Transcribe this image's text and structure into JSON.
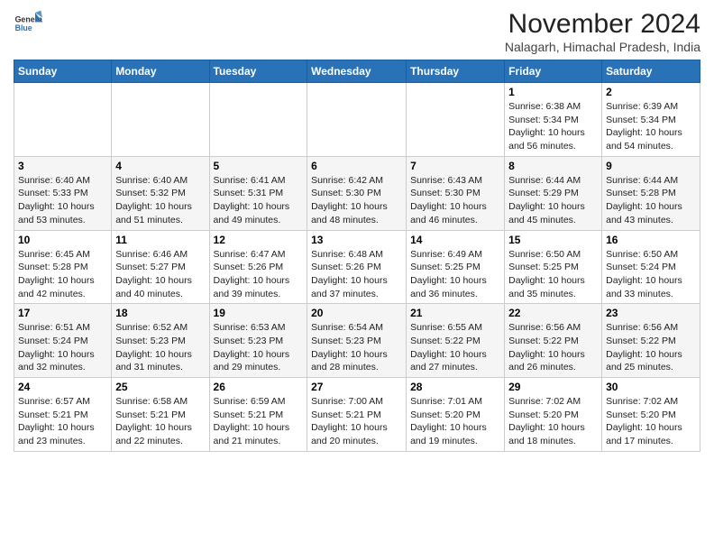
{
  "header": {
    "logo": {
      "line1": "General",
      "line2": "Blue"
    },
    "month": "November 2024",
    "location": "Nalagarh, Himachal Pradesh, India"
  },
  "weekdays": [
    "Sunday",
    "Monday",
    "Tuesday",
    "Wednesday",
    "Thursday",
    "Friday",
    "Saturday"
  ],
  "weeks": [
    [
      {
        "day": "",
        "info": ""
      },
      {
        "day": "",
        "info": ""
      },
      {
        "day": "",
        "info": ""
      },
      {
        "day": "",
        "info": ""
      },
      {
        "day": "",
        "info": ""
      },
      {
        "day": "1",
        "info": "Sunrise: 6:38 AM\nSunset: 5:34 PM\nDaylight: 10 hours and 56 minutes."
      },
      {
        "day": "2",
        "info": "Sunrise: 6:39 AM\nSunset: 5:34 PM\nDaylight: 10 hours and 54 minutes."
      }
    ],
    [
      {
        "day": "3",
        "info": "Sunrise: 6:40 AM\nSunset: 5:33 PM\nDaylight: 10 hours and 53 minutes."
      },
      {
        "day": "4",
        "info": "Sunrise: 6:40 AM\nSunset: 5:32 PM\nDaylight: 10 hours and 51 minutes."
      },
      {
        "day": "5",
        "info": "Sunrise: 6:41 AM\nSunset: 5:31 PM\nDaylight: 10 hours and 49 minutes."
      },
      {
        "day": "6",
        "info": "Sunrise: 6:42 AM\nSunset: 5:30 PM\nDaylight: 10 hours and 48 minutes."
      },
      {
        "day": "7",
        "info": "Sunrise: 6:43 AM\nSunset: 5:30 PM\nDaylight: 10 hours and 46 minutes."
      },
      {
        "day": "8",
        "info": "Sunrise: 6:44 AM\nSunset: 5:29 PM\nDaylight: 10 hours and 45 minutes."
      },
      {
        "day": "9",
        "info": "Sunrise: 6:44 AM\nSunset: 5:28 PM\nDaylight: 10 hours and 43 minutes."
      }
    ],
    [
      {
        "day": "10",
        "info": "Sunrise: 6:45 AM\nSunset: 5:28 PM\nDaylight: 10 hours and 42 minutes."
      },
      {
        "day": "11",
        "info": "Sunrise: 6:46 AM\nSunset: 5:27 PM\nDaylight: 10 hours and 40 minutes."
      },
      {
        "day": "12",
        "info": "Sunrise: 6:47 AM\nSunset: 5:26 PM\nDaylight: 10 hours and 39 minutes."
      },
      {
        "day": "13",
        "info": "Sunrise: 6:48 AM\nSunset: 5:26 PM\nDaylight: 10 hours and 37 minutes."
      },
      {
        "day": "14",
        "info": "Sunrise: 6:49 AM\nSunset: 5:25 PM\nDaylight: 10 hours and 36 minutes."
      },
      {
        "day": "15",
        "info": "Sunrise: 6:50 AM\nSunset: 5:25 PM\nDaylight: 10 hours and 35 minutes."
      },
      {
        "day": "16",
        "info": "Sunrise: 6:50 AM\nSunset: 5:24 PM\nDaylight: 10 hours and 33 minutes."
      }
    ],
    [
      {
        "day": "17",
        "info": "Sunrise: 6:51 AM\nSunset: 5:24 PM\nDaylight: 10 hours and 32 minutes."
      },
      {
        "day": "18",
        "info": "Sunrise: 6:52 AM\nSunset: 5:23 PM\nDaylight: 10 hours and 31 minutes."
      },
      {
        "day": "19",
        "info": "Sunrise: 6:53 AM\nSunset: 5:23 PM\nDaylight: 10 hours and 29 minutes."
      },
      {
        "day": "20",
        "info": "Sunrise: 6:54 AM\nSunset: 5:23 PM\nDaylight: 10 hours and 28 minutes."
      },
      {
        "day": "21",
        "info": "Sunrise: 6:55 AM\nSunset: 5:22 PM\nDaylight: 10 hours and 27 minutes."
      },
      {
        "day": "22",
        "info": "Sunrise: 6:56 AM\nSunset: 5:22 PM\nDaylight: 10 hours and 26 minutes."
      },
      {
        "day": "23",
        "info": "Sunrise: 6:56 AM\nSunset: 5:22 PM\nDaylight: 10 hours and 25 minutes."
      }
    ],
    [
      {
        "day": "24",
        "info": "Sunrise: 6:57 AM\nSunset: 5:21 PM\nDaylight: 10 hours and 23 minutes."
      },
      {
        "day": "25",
        "info": "Sunrise: 6:58 AM\nSunset: 5:21 PM\nDaylight: 10 hours and 22 minutes."
      },
      {
        "day": "26",
        "info": "Sunrise: 6:59 AM\nSunset: 5:21 PM\nDaylight: 10 hours and 21 minutes."
      },
      {
        "day": "27",
        "info": "Sunrise: 7:00 AM\nSunset: 5:21 PM\nDaylight: 10 hours and 20 minutes."
      },
      {
        "day": "28",
        "info": "Sunrise: 7:01 AM\nSunset: 5:20 PM\nDaylight: 10 hours and 19 minutes."
      },
      {
        "day": "29",
        "info": "Sunrise: 7:02 AM\nSunset: 5:20 PM\nDaylight: 10 hours and 18 minutes."
      },
      {
        "day": "30",
        "info": "Sunrise: 7:02 AM\nSunset: 5:20 PM\nDaylight: 10 hours and 17 minutes."
      }
    ]
  ]
}
